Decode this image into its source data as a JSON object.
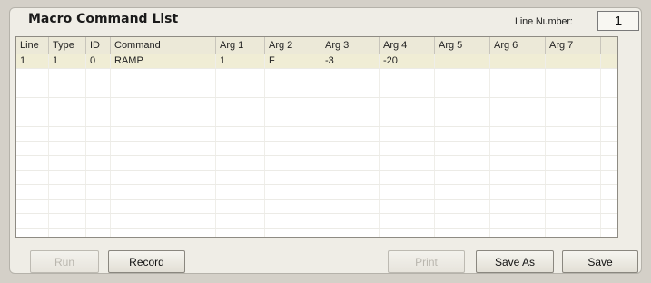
{
  "panel": {
    "title": "Macro Command List",
    "line_number_label": "Line Number:",
    "line_number_value": "1"
  },
  "table": {
    "columns": [
      "Line",
      "Type",
      "ID",
      "Command",
      "Arg 1",
      "Arg 2",
      "Arg 3",
      "Arg 4",
      "Arg 5",
      "Arg 6",
      "Arg 7"
    ],
    "rows": [
      [
        "1",
        "1",
        "0",
        "RAMP",
        "1",
        "F",
        "-3",
        "-20",
        "",
        "",
        ""
      ]
    ],
    "selected_row": 0
  },
  "buttons": {
    "run": "Run",
    "record": "Record",
    "print": "Print",
    "save_as": "Save As",
    "save": "Save"
  },
  "colors": {
    "selected_row": "#f0edd5",
    "panel_bg": "#efede6",
    "window_bg": "#d4d0c8"
  }
}
